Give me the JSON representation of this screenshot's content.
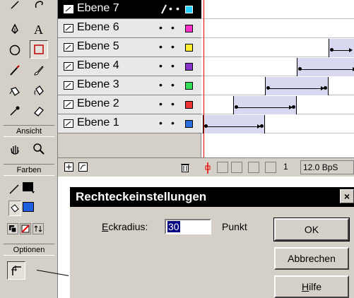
{
  "toolbox": {
    "section_view": "Ansicht",
    "section_colors": "Farben",
    "section_options": "Optionen",
    "tools": [
      "line-tool",
      "lasso-tool",
      "pen-tool",
      "text-tool",
      "oval-tool",
      "rectangle-tool",
      "pencil-tool",
      "brush-tool",
      "ink-bottle-tool",
      "paint-bucket-tool",
      "dropper-tool",
      "eraser-tool",
      "hand-tool",
      "zoom-tool"
    ],
    "stroke_color": "#000000",
    "fill_color": "#1e5fe0"
  },
  "layers": [
    {
      "name": "Ebene 7",
      "color": "#2ad0ff",
      "active": true
    },
    {
      "name": "Ebene 6",
      "color": "#ff33cc",
      "active": false
    },
    {
      "name": "Ebene 5",
      "color": "#ffee33",
      "active": false
    },
    {
      "name": "Ebene 4",
      "color": "#8833cc",
      "active": false
    },
    {
      "name": "Ebene 3",
      "color": "#33dd55",
      "active": false
    },
    {
      "name": "Ebene 2",
      "color": "#ee3333",
      "active": false
    },
    {
      "name": "Ebene 1",
      "color": "#2a6fe0",
      "active": false
    }
  ],
  "timeline": {
    "current_frame": "1",
    "frame_rate": "12.0 BpS"
  },
  "dialog": {
    "title": "Rechteckeinstellungen",
    "close": "×",
    "radius_label_prefix": "E",
    "radius_label_rest": "ckradius:",
    "radius_value": "30",
    "unit": "Punkt",
    "ok": "OK",
    "cancel": "Abbrechen",
    "help_prefix": "H",
    "help_rest": "ilfe"
  }
}
